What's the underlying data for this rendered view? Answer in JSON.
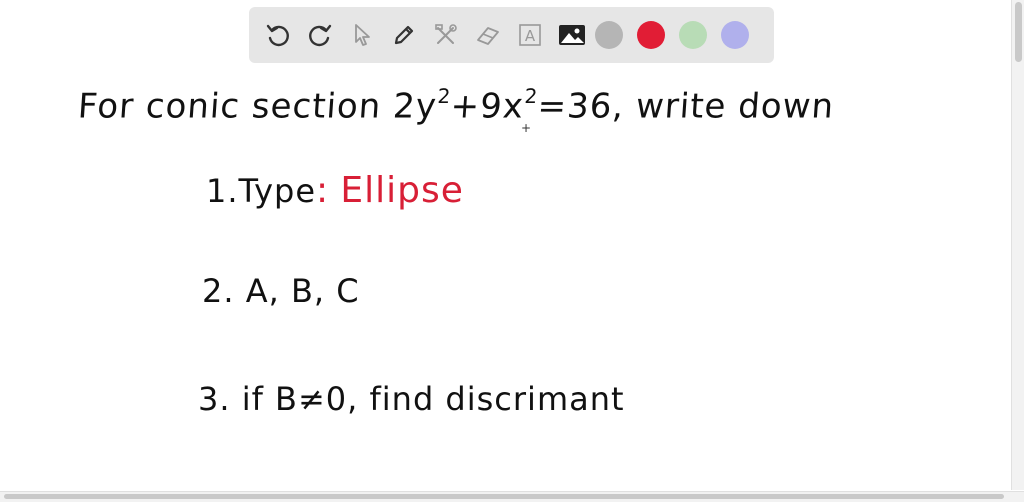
{
  "toolbar": {
    "tools": [
      {
        "name": "undo-icon"
      },
      {
        "name": "redo-icon"
      },
      {
        "name": "select-pointer-icon"
      },
      {
        "name": "pen-icon"
      },
      {
        "name": "tools-icon"
      },
      {
        "name": "eraser-icon"
      },
      {
        "name": "text-icon",
        "glyph": "A"
      },
      {
        "name": "image-icon"
      }
    ],
    "colors": [
      "#b5b5b5",
      "#e11d35",
      "#b8dcb6",
      "#b0b0ec"
    ]
  },
  "board": {
    "line1": {
      "prefix": "For conic section 2y",
      "exp1": "2",
      "mid": "+9x",
      "exp2": "2",
      "suffix": "=36, write down"
    },
    "item1": {
      "label": "1.Type",
      "colon": ":",
      "answer": "Ellipse"
    },
    "item2": {
      "label": "2. A, B, C"
    },
    "item3": {
      "label": "3. if B≠0, find discrimant"
    },
    "cursor": "+"
  }
}
